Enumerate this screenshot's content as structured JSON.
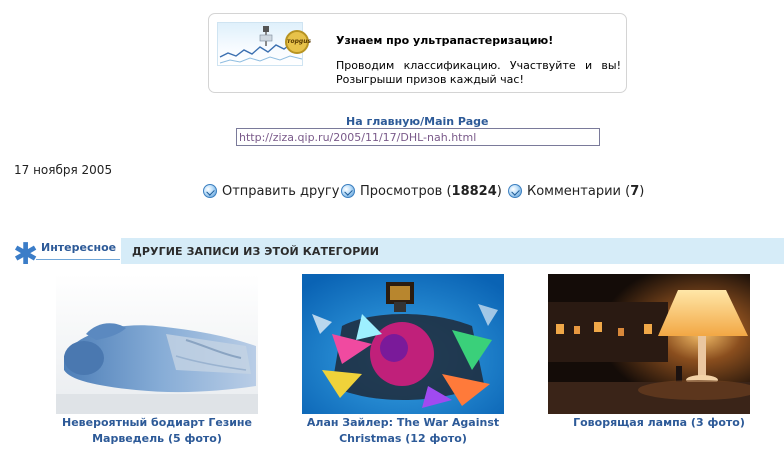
{
  "ad": {
    "badge": "торgus",
    "title": "Узнаем про ультрапастеризацию!",
    "text": "Проводим классификацию. Участвуйте и вы! Розыгрыши призов каждый час!"
  },
  "nav": {
    "main_link": "На главную/Main Page",
    "url_value": "http://ziza.qip.ru/2005/11/17/DHL-nah.html"
  },
  "post": {
    "date": "17 ноября 2005",
    "send_friend": "Отправить другу",
    "views_label": "Просмотров (",
    "views_count": "18824",
    "views_close": ")",
    "comments_label": "Комментарии (",
    "comments_count": "7",
    "comments_close": ")"
  },
  "section": {
    "tab_label": "Интересное",
    "title": "ДРУГИЕ ЗАПИСИ ИЗ ЭТОЙ КАТЕГОРИИ"
  },
  "related": [
    {
      "line1": "Невероятный бодиарт Гезине",
      "line2": "Марведель (5 фото)"
    },
    {
      "line1": "Алан Зайлер: The War Against",
      "line2": "Christmas (12 фото)"
    },
    {
      "line1": "Говорящая лампа (3 фото)",
      "line2": ""
    }
  ],
  "colors": {
    "link": "#2d5a98",
    "section_bar": "#d6ecf8",
    "accent_icon": "#3b7dc8"
  }
}
